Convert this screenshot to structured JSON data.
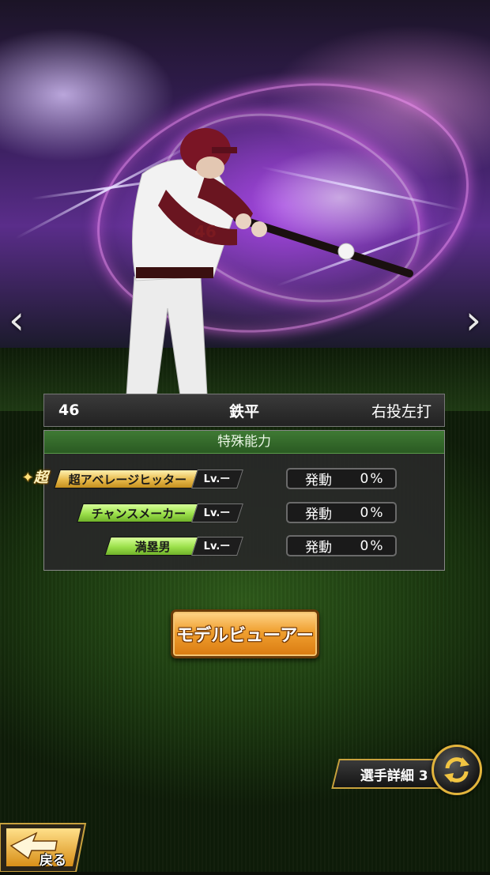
{
  "player": {
    "number": "46",
    "name": "鉄平",
    "throw_bat": "右投左打"
  },
  "abilities": {
    "header": "特殊能力",
    "items": [
      {
        "badge": "超",
        "name": "超アベレージヒッター",
        "level": "Lv.ー",
        "trigger_label": "発動",
        "rate": "0%",
        "style": "gold"
      },
      {
        "name": "チャンスメーカー",
        "level": "Lv.ー",
        "trigger_label": "発動",
        "rate": "0%",
        "style": "green"
      },
      {
        "name": "満塁男",
        "level": "Lv.ー",
        "trigger_label": "発動",
        "rate": "0%",
        "style": "green"
      }
    ]
  },
  "buttons": {
    "model_viewer": "モデルビューアー",
    "player_detail": "選手詳細 3",
    "back": "戻る"
  },
  "icons": {
    "prev": "chevron-left-icon",
    "next": "chevron-right-icon",
    "switch": "swap-arrows-icon",
    "back": "back-arrow-icon"
  },
  "colors": {
    "ability_header": "#3f7a34",
    "gold_plate": "#e7b94a",
    "green_plate": "#9be04a",
    "button_orange": "#f0a030"
  }
}
